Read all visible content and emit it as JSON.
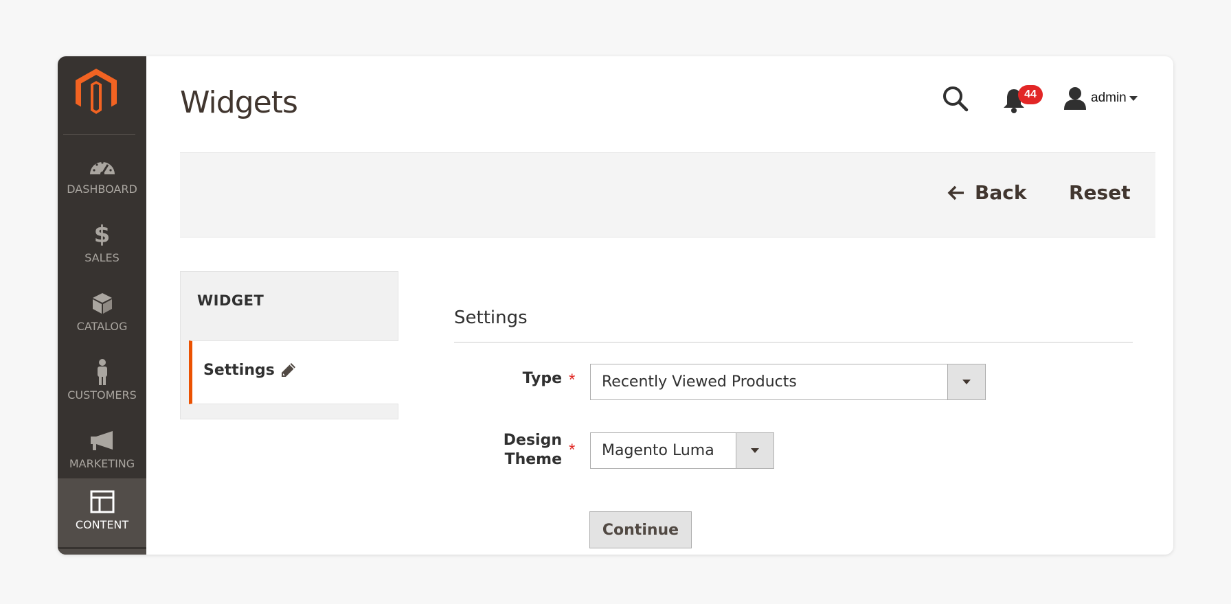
{
  "brand": {
    "accent": "#eb5202",
    "sidebar_bg": "#373330",
    "logo": "magento-logo"
  },
  "header": {
    "title": "Widgets",
    "notifications_count": "44",
    "user_name": "admin",
    "icons": {
      "search": "search-icon",
      "notifications": "bell-icon",
      "user": "user-icon"
    }
  },
  "sidebar": {
    "items": [
      {
        "label": "DASHBOARD",
        "icon": "dashboard-icon",
        "active": false
      },
      {
        "label": "SALES",
        "icon": "dollar-icon",
        "active": false
      },
      {
        "label": "CATALOG",
        "icon": "box-icon",
        "active": false
      },
      {
        "label": "CUSTOMERS",
        "icon": "person-icon",
        "active": false
      },
      {
        "label": "MARKETING",
        "icon": "megaphone-icon",
        "active": false
      },
      {
        "label": "CONTENT",
        "icon": "layout-icon",
        "active": true
      }
    ]
  },
  "action_bar": {
    "back_label": "Back",
    "reset_label": "Reset"
  },
  "tabs": {
    "title": "WIDGET",
    "items": [
      {
        "label": "Settings",
        "active": true
      }
    ]
  },
  "form": {
    "section_title": "Settings",
    "fields": [
      {
        "label": "Type",
        "required": true,
        "value": "Recently Viewed Products"
      },
      {
        "label_line1": "Design",
        "label_line2": "Theme",
        "required": true,
        "value": "Magento Luma"
      }
    ],
    "continue_label": "Continue"
  }
}
